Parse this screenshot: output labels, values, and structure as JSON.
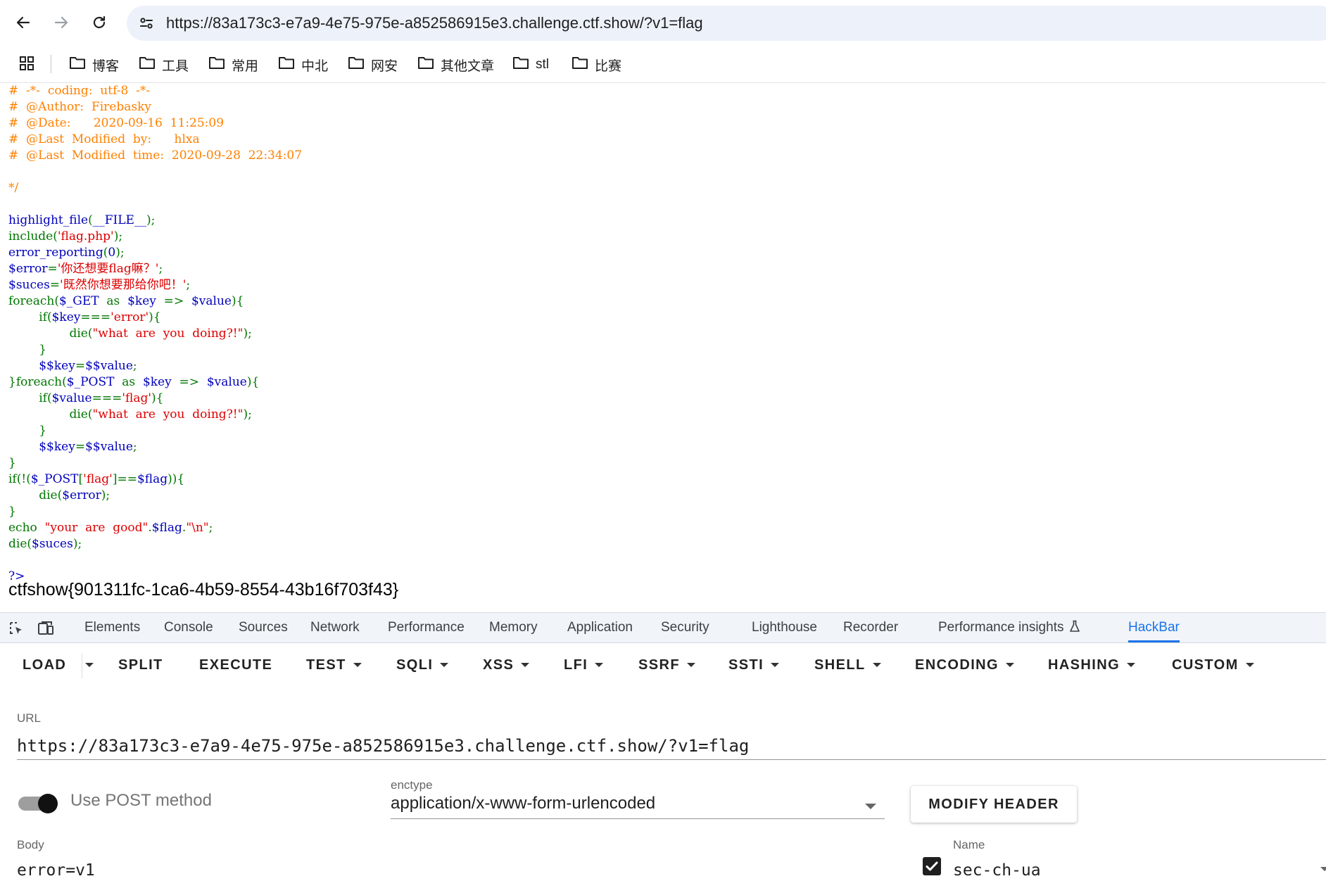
{
  "browser": {
    "url": "https://83a173c3-e7a9-4e75-975e-a852586915e3.challenge.ctf.show/?v1=flag",
    "bookmarks": [
      {
        "label": "博客"
      },
      {
        "label": "工具"
      },
      {
        "label": "常用"
      },
      {
        "label": "中北"
      },
      {
        "label": "网安"
      },
      {
        "label": "其他文章"
      },
      {
        "label": "stl"
      },
      {
        "label": "比赛"
      }
    ]
  },
  "source": {
    "colors": {
      "comment": "#ff8000",
      "default": "#0000bb",
      "keyword": "#007700",
      "string": "#dd0000"
    },
    "lines": [
      [
        {
          "t": "#  -*-  coding:  utf-8  -*-",
          "c": "com"
        }
      ],
      [
        {
          "t": "#  @Author:  Firebasky",
          "c": "com"
        }
      ],
      [
        {
          "t": "#  @Date:      2020-09-16  11:25:09",
          "c": "com"
        }
      ],
      [
        {
          "t": "#  @Last  Modified  by:      hlxa",
          "c": "com"
        }
      ],
      [
        {
          "t": "#  @Last  Modified  time:  2020-09-28  22:34:07",
          "c": "com"
        }
      ],
      [],
      [
        {
          "t": "*/",
          "c": "com"
        }
      ],
      [],
      [
        {
          "t": "highlight_file",
          "c": "def"
        },
        {
          "t": "(",
          "c": "kw"
        },
        {
          "t": "__FILE__",
          "c": "def"
        },
        {
          "t": ");",
          "c": "kw"
        }
      ],
      [
        {
          "t": "include(",
          "c": "kw"
        },
        {
          "t": "'flag.php'",
          "c": "str"
        },
        {
          "t": ");",
          "c": "kw"
        }
      ],
      [
        {
          "t": "error_reporting",
          "c": "def"
        },
        {
          "t": "(",
          "c": "kw"
        },
        {
          "t": "0",
          "c": "def"
        },
        {
          "t": ");",
          "c": "kw"
        }
      ],
      [
        {
          "t": "$error",
          "c": "def"
        },
        {
          "t": "=",
          "c": "kw"
        },
        {
          "t": "'你还想要flag嘛？'",
          "c": "str"
        },
        {
          "t": ";",
          "c": "kw"
        }
      ],
      [
        {
          "t": "$suces",
          "c": "def"
        },
        {
          "t": "=",
          "c": "kw"
        },
        {
          "t": "'既然你想要那给你吧！'",
          "c": "str"
        },
        {
          "t": ";",
          "c": "kw"
        }
      ],
      [
        {
          "t": "foreach(",
          "c": "kw"
        },
        {
          "t": "$_GET  ",
          "c": "def"
        },
        {
          "t": "as  ",
          "c": "kw"
        },
        {
          "t": "$key  ",
          "c": "def"
        },
        {
          "t": "=>  ",
          "c": "kw"
        },
        {
          "t": "$value",
          "c": "def"
        },
        {
          "t": "){",
          "c": "kw"
        }
      ],
      [
        {
          "t": "        if(",
          "c": "kw"
        },
        {
          "t": "$key",
          "c": "def"
        },
        {
          "t": "===",
          "c": "kw"
        },
        {
          "t": "'error'",
          "c": "str"
        },
        {
          "t": "){",
          "c": "kw"
        }
      ],
      [
        {
          "t": "                die(",
          "c": "kw"
        },
        {
          "t": "\"what  are  you  doing?!\"",
          "c": "str"
        },
        {
          "t": ");",
          "c": "kw"
        }
      ],
      [
        {
          "t": "        }",
          "c": "kw"
        }
      ],
      [
        {
          "t": "        $$key",
          "c": "def"
        },
        {
          "t": "=",
          "c": "kw"
        },
        {
          "t": "$$value",
          "c": "def"
        },
        {
          "t": ";",
          "c": "kw"
        }
      ],
      [
        {
          "t": "}foreach(",
          "c": "kw"
        },
        {
          "t": "$_POST  ",
          "c": "def"
        },
        {
          "t": "as  ",
          "c": "kw"
        },
        {
          "t": "$key  ",
          "c": "def"
        },
        {
          "t": "=>  ",
          "c": "kw"
        },
        {
          "t": "$value",
          "c": "def"
        },
        {
          "t": "){",
          "c": "kw"
        }
      ],
      [
        {
          "t": "        if(",
          "c": "kw"
        },
        {
          "t": "$value",
          "c": "def"
        },
        {
          "t": "===",
          "c": "kw"
        },
        {
          "t": "'flag'",
          "c": "str"
        },
        {
          "t": "){",
          "c": "kw"
        }
      ],
      [
        {
          "t": "                die(",
          "c": "kw"
        },
        {
          "t": "\"what  are  you  doing?!\"",
          "c": "str"
        },
        {
          "t": ");",
          "c": "kw"
        }
      ],
      [
        {
          "t": "        }",
          "c": "kw"
        }
      ],
      [
        {
          "t": "        $$key",
          "c": "def"
        },
        {
          "t": "=",
          "c": "kw"
        },
        {
          "t": "$$value",
          "c": "def"
        },
        {
          "t": ";",
          "c": "kw"
        }
      ],
      [
        {
          "t": "}",
          "c": "kw"
        }
      ],
      [
        {
          "t": "if(!(",
          "c": "kw"
        },
        {
          "t": "$_POST",
          "c": "def"
        },
        {
          "t": "[",
          "c": "kw"
        },
        {
          "t": "'flag'",
          "c": "str"
        },
        {
          "t": "]==",
          "c": "kw"
        },
        {
          "t": "$flag",
          "c": "def"
        },
        {
          "t": ")){",
          "c": "kw"
        }
      ],
      [
        {
          "t": "        die(",
          "c": "kw"
        },
        {
          "t": "$error",
          "c": "def"
        },
        {
          "t": ");",
          "c": "kw"
        }
      ],
      [
        {
          "t": "}",
          "c": "kw"
        }
      ],
      [
        {
          "t": "echo  ",
          "c": "kw"
        },
        {
          "t": "\"your  are  good\"",
          "c": "str"
        },
        {
          "t": ".",
          "c": "kw"
        },
        {
          "t": "$flag",
          "c": "def"
        },
        {
          "t": ".",
          "c": "kw"
        },
        {
          "t": "\"\\n\"",
          "c": "str"
        },
        {
          "t": ";",
          "c": "kw"
        }
      ],
      [
        {
          "t": "die(",
          "c": "kw"
        },
        {
          "t": "$suces",
          "c": "def"
        },
        {
          "t": ");",
          "c": "kw"
        }
      ],
      [],
      [
        {
          "t": "?>",
          "c": "def"
        }
      ]
    ]
  },
  "output": {
    "flag": "ctfshow{901311fc-1ca6-4b59-8554-43b16f703f43}"
  },
  "devtools": {
    "tabs": [
      {
        "label": "Elements",
        "active": false
      },
      {
        "label": "Console",
        "active": false
      },
      {
        "label": "Sources",
        "active": false
      },
      {
        "label": "Network",
        "active": false
      },
      {
        "label": "Performance",
        "active": false
      },
      {
        "label": "Memory",
        "active": false
      },
      {
        "label": "Application",
        "active": false
      },
      {
        "label": "Security",
        "active": false
      },
      {
        "label": "Lighthouse",
        "active": false
      },
      {
        "label": "Recorder",
        "active": false
      },
      {
        "label": "Performance insights",
        "active": false
      },
      {
        "label": "HackBar",
        "active": true
      }
    ],
    "accent_color": "#1a73e8"
  },
  "hackbar": {
    "menu": [
      {
        "label": "LOAD",
        "dropdown": false
      },
      {
        "label": "SPLIT",
        "dropdown": false
      },
      {
        "label": "EXECUTE",
        "dropdown": false
      },
      {
        "label": "TEST",
        "dropdown": true
      },
      {
        "label": "SQLI",
        "dropdown": true
      },
      {
        "label": "XSS",
        "dropdown": true
      },
      {
        "label": "LFI",
        "dropdown": true
      },
      {
        "label": "SSRF",
        "dropdown": true
      },
      {
        "label": "SSTI",
        "dropdown": true
      },
      {
        "label": "SHELL",
        "dropdown": true
      },
      {
        "label": "ENCODING",
        "dropdown": true
      },
      {
        "label": "HASHING",
        "dropdown": true
      },
      {
        "label": "CUSTOM",
        "dropdown": true
      }
    ],
    "url_label": "URL",
    "url_value": "https://83a173c3-e7a9-4e75-975e-a852586915e3.challenge.ctf.show/?v1=flag",
    "post_toggle_label": "Use POST method",
    "post_enabled": true,
    "enctype_label": "enctype",
    "enctype_value": "application/x-www-form-urlencoded",
    "modify_header_label": "MODIFY HEADER",
    "body_label": "Body",
    "body_value": "error=v1",
    "header_name_label": "Name",
    "header_name_value": "sec-ch-ua",
    "header_checked": true
  }
}
